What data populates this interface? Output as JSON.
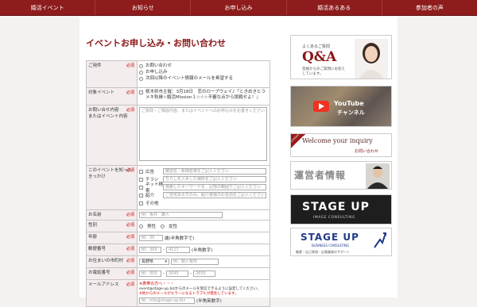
{
  "nav": {
    "items": [
      "婚活イベント",
      "お知らせ",
      "お申し込み",
      "婚活あるある",
      "参加者の声"
    ]
  },
  "page_title": "イベントお申し込み・お問い合わせ",
  "required_mark": "必須",
  "form": {
    "purpose": {
      "label": "ご用件",
      "options": [
        "お問い合わせ",
        "お申し込み",
        "次回以降のイベント情報のメールを希望する"
      ]
    },
    "event": {
      "label": "対象イベント",
      "value": "栃木県市主催：3月18日　恋のロープウェイ♪『ときめきヒラメキ秋縁☆婚活Mission１☆☆☆不審な点から挑戦せよ！』"
    },
    "inquiry": {
      "label": "お問い合せ内容\nまたはイベント内容",
      "placeholder": "ご質問・ご相談内容、またはイベントへのお申込みをお書きください"
    },
    "how_known": {
      "label": "このイベントを知ったきっかけ",
      "options": [
        {
          "label": "広告",
          "placeholder": "雑誌名・新聞名等をご記入ください"
        },
        {
          "label": "チラシ",
          "placeholder": "ちらしを入手した場所をご記入ください"
        },
        {
          "label": "ネット検索",
          "placeholder": "検索したキーワードを、記憶の範囲でご記入ください"
        },
        {
          "label": "紹介",
          "placeholder": "ご自宅ある方のみ、紹介者様のお名前をご記入ください"
        },
        {
          "label": "その他",
          "placeholder": ""
        }
      ]
    },
    "name": {
      "label": "お名前",
      "placeholder": "例：坂井　康人"
    },
    "gender": {
      "label": "性別",
      "options": [
        "男性",
        "女性"
      ]
    },
    "age": {
      "label": "年齢",
      "placeholder": "例：35",
      "suffix": "歳(半角数字で)"
    },
    "postal": {
      "label": "郵便番号",
      "part1": "例：399",
      "part2": "4117",
      "suffix": "(半角数字)"
    },
    "address": {
      "label": "お住まいの市町村",
      "select_value": "長野県",
      "placeholder": "例：駒ヶ根市"
    },
    "phone": {
      "label": "お電話番号",
      "part1": "例：050",
      "part2": "3045",
      "part3": "2650"
    },
    "email": {
      "label": "メールアドレス",
      "note1": "※携帯の方へ・・・",
      "note2": "event@stage-up.bizからのメールを受信できるように設定してください。",
      "note3": "※他からのメールがエラーになるトラブルが発生しています。",
      "placeholder": "例：info@stage-up.biz",
      "suffix": "(半角英数字)"
    }
  },
  "sidebar": {
    "qa": {
      "small": "よくあるご質問",
      "title": "Q&A",
      "desc": "皆様からのご質問にお答えしています。"
    },
    "youtube": {
      "brand": "YouTube",
      "sub": "チャンネル"
    },
    "inquiry": {
      "ribbon": "Contact",
      "welcome": "Welcome your inquiry",
      "sub": "お問い合わせ"
    },
    "operator": {
      "text": "運営者情報"
    },
    "stageup1": {
      "title": "STAGE UP",
      "sub": "IMAGE CONSULTING"
    },
    "stageup2": {
      "title": "STAGE UP",
      "sub": "BUSINESS CONSULTING",
      "desc": "集客・自己表現・広報業務のサポート"
    }
  },
  "colors": {
    "brand": "#8e1c1c",
    "accent_red": "#cc0000"
  }
}
